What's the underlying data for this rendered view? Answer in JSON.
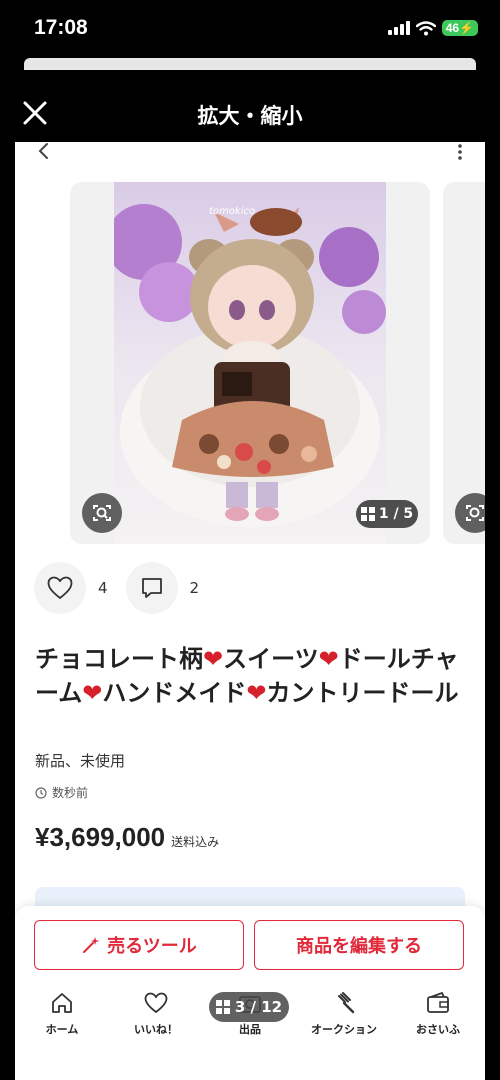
{
  "status": {
    "time": "17:08",
    "battery": "46"
  },
  "zoom_header": {
    "title": "拡大・縮小"
  },
  "image": {
    "counter": "1 / 5",
    "watermark": "tomokico"
  },
  "actions": {
    "like_count": "4",
    "comment_count": "2"
  },
  "item": {
    "title_parts": [
      "チョコレート柄",
      "❤",
      "スイーツ",
      "❤",
      "ドールチャーム",
      "❤",
      "ハンドメイド",
      "❤",
      "カントリードール"
    ],
    "condition": "新品、未使用",
    "posted": "数秒前",
    "price": "¥3,699,000",
    "shipping": "送料込み"
  },
  "buttons": {
    "sell_tool": "売るツール",
    "edit_item": "商品を編集する"
  },
  "tabbar": {
    "items": [
      {
        "label": "ホーム",
        "icon": "home-icon"
      },
      {
        "label": "いいね！",
        "icon": "heart-icon"
      },
      {
        "label": "出品",
        "icon": "camera-icon"
      },
      {
        "label": "オークション",
        "icon": "gavel-icon"
      },
      {
        "label": "おさいふ",
        "icon": "wallet-icon"
      }
    ],
    "page_indicator": "3 / 12"
  },
  "colors": {
    "accent": "#e02a3a",
    "heart": "#d6202c",
    "battery": "#3cc85a"
  }
}
